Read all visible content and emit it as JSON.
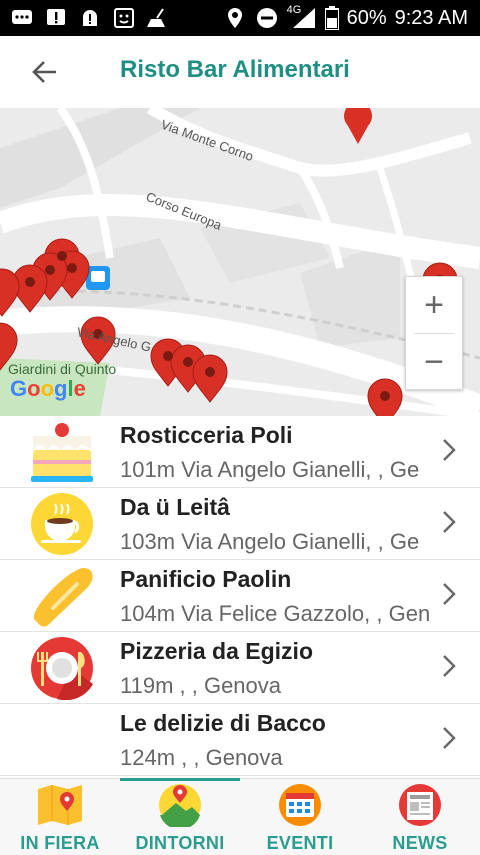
{
  "status_bar": {
    "network": "4G",
    "battery": "60%",
    "time": "9:23 AM"
  },
  "header": {
    "title": "Risto Bar Alimentari"
  },
  "map": {
    "street_labels": [
      "Via Monte Corno",
      "Corso Europa",
      "Via Angelo G"
    ],
    "park_label": "Giardini di Quinto",
    "zoom_in": "+",
    "zoom_out": "−",
    "logo": "Google"
  },
  "places": [
    {
      "name": "Rosticceria Poli",
      "address": "101m Via Angelo Gianelli, , Ge",
      "icon": "cake-icon"
    },
    {
      "name": "Da ü Leitâ",
      "address": "103m Via Angelo Gianelli, , Ge",
      "icon": "coffee-cup-icon"
    },
    {
      "name": "Panificio Paolin",
      "address": "104m Via Felice Gazzolo, , Gen",
      "icon": "bread-icon"
    },
    {
      "name": "Pizzeria da Egizio",
      "address": "119m , , Genova",
      "icon": "plate-cutlery-icon"
    },
    {
      "name": "Le delizie di Bacco",
      "address": "124m , , Genova",
      "icon": ""
    }
  ],
  "nav": {
    "tabs": [
      {
        "label": "IN FIERA",
        "icon": "map-pin-icon"
      },
      {
        "label": "DINTORNI",
        "icon": "location-person-icon",
        "active": true
      },
      {
        "label": "EVENTI",
        "icon": "calendar-icon"
      },
      {
        "label": "NEWS",
        "icon": "newspaper-icon"
      }
    ]
  },
  "colors": {
    "accent": "#2a9d8f",
    "pin": "#e53935"
  }
}
